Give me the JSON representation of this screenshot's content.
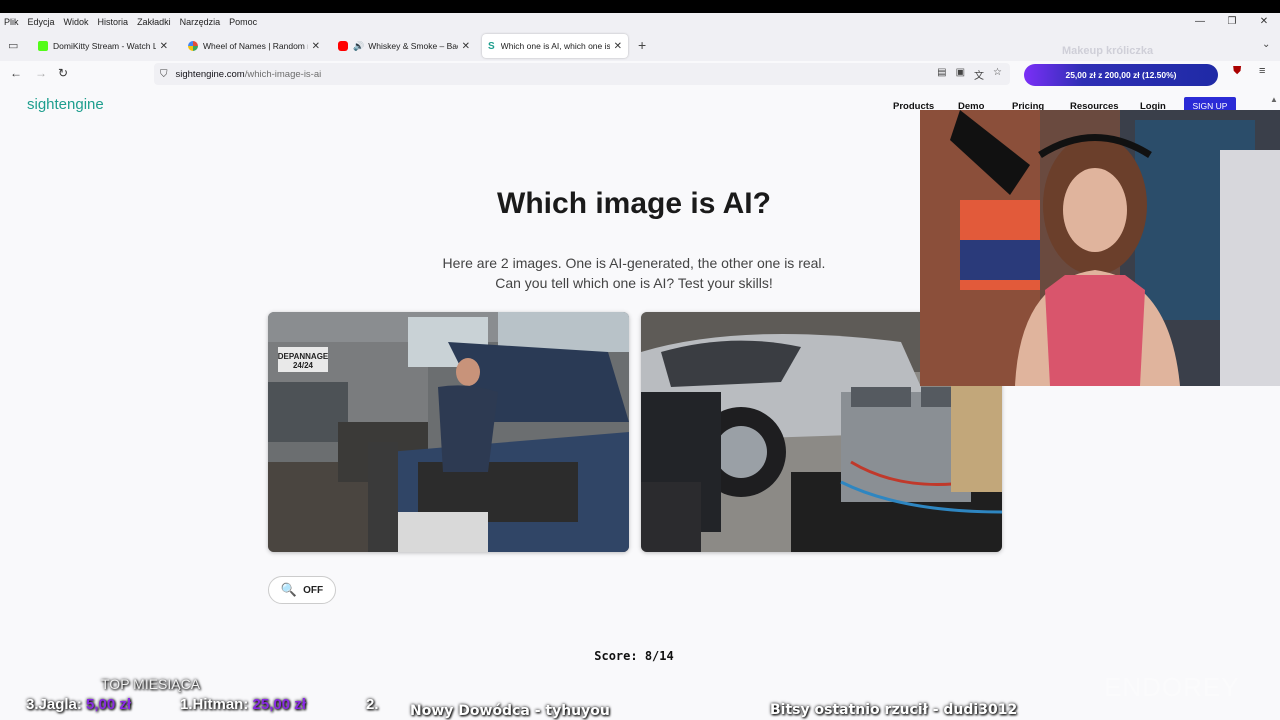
{
  "menubar": {
    "items": [
      "Plik",
      "Edycja",
      "Widok",
      "Historia",
      "Zakładki",
      "Narzędzia",
      "Pomoc"
    ]
  },
  "tabs": [
    {
      "title": "DomiKitty Stream - Watch Live",
      "color": "#53fc18"
    },
    {
      "title": "Wheel of Names | Random nam",
      "color": "#e04d3b"
    },
    {
      "title": "Whiskey & Smoke – Bad Gi",
      "color": "#ff0000"
    },
    {
      "title": "Which one is AI, which one is re",
      "color": "#1e9e8e"
    }
  ],
  "address": {
    "domain": "sightengine.com",
    "path": "/which-image-is-ai"
  },
  "overlay": {
    "makeup": "Makeup króliczka",
    "donation": "25,00 zł z 200,00 zł (12.50%)",
    "top_label": "TOP MIESIĄCA",
    "rank3_name": "3.Jagla:",
    "rank3_amount": "5,00 zł",
    "rank1_name": "1.Hitman:",
    "rank1_amount": "25,00 zł",
    "rank2_name": "2.",
    "commander": "Nowy Dowódca - tyhuyou",
    "bits": "Bitsy ostatnio rzucił - dudi3012",
    "watermark": "ENDOREY"
  },
  "site": {
    "logo": "sightengine",
    "nav": [
      "Products",
      "Demo",
      "Pricing",
      "Resources",
      "Login"
    ],
    "signup": "SIGN UP",
    "title": "Which image is AI?",
    "subtitle_line1": "Here are 2 images. One is AI-generated, the other one is real.",
    "subtitle_line2": "Can you tell which one is AI? Test your skills!",
    "off_label": "OFF",
    "score": "Score: 8/14",
    "image1_sign_1": "DEPANNAGE",
    "image1_sign_2": "24/24"
  }
}
